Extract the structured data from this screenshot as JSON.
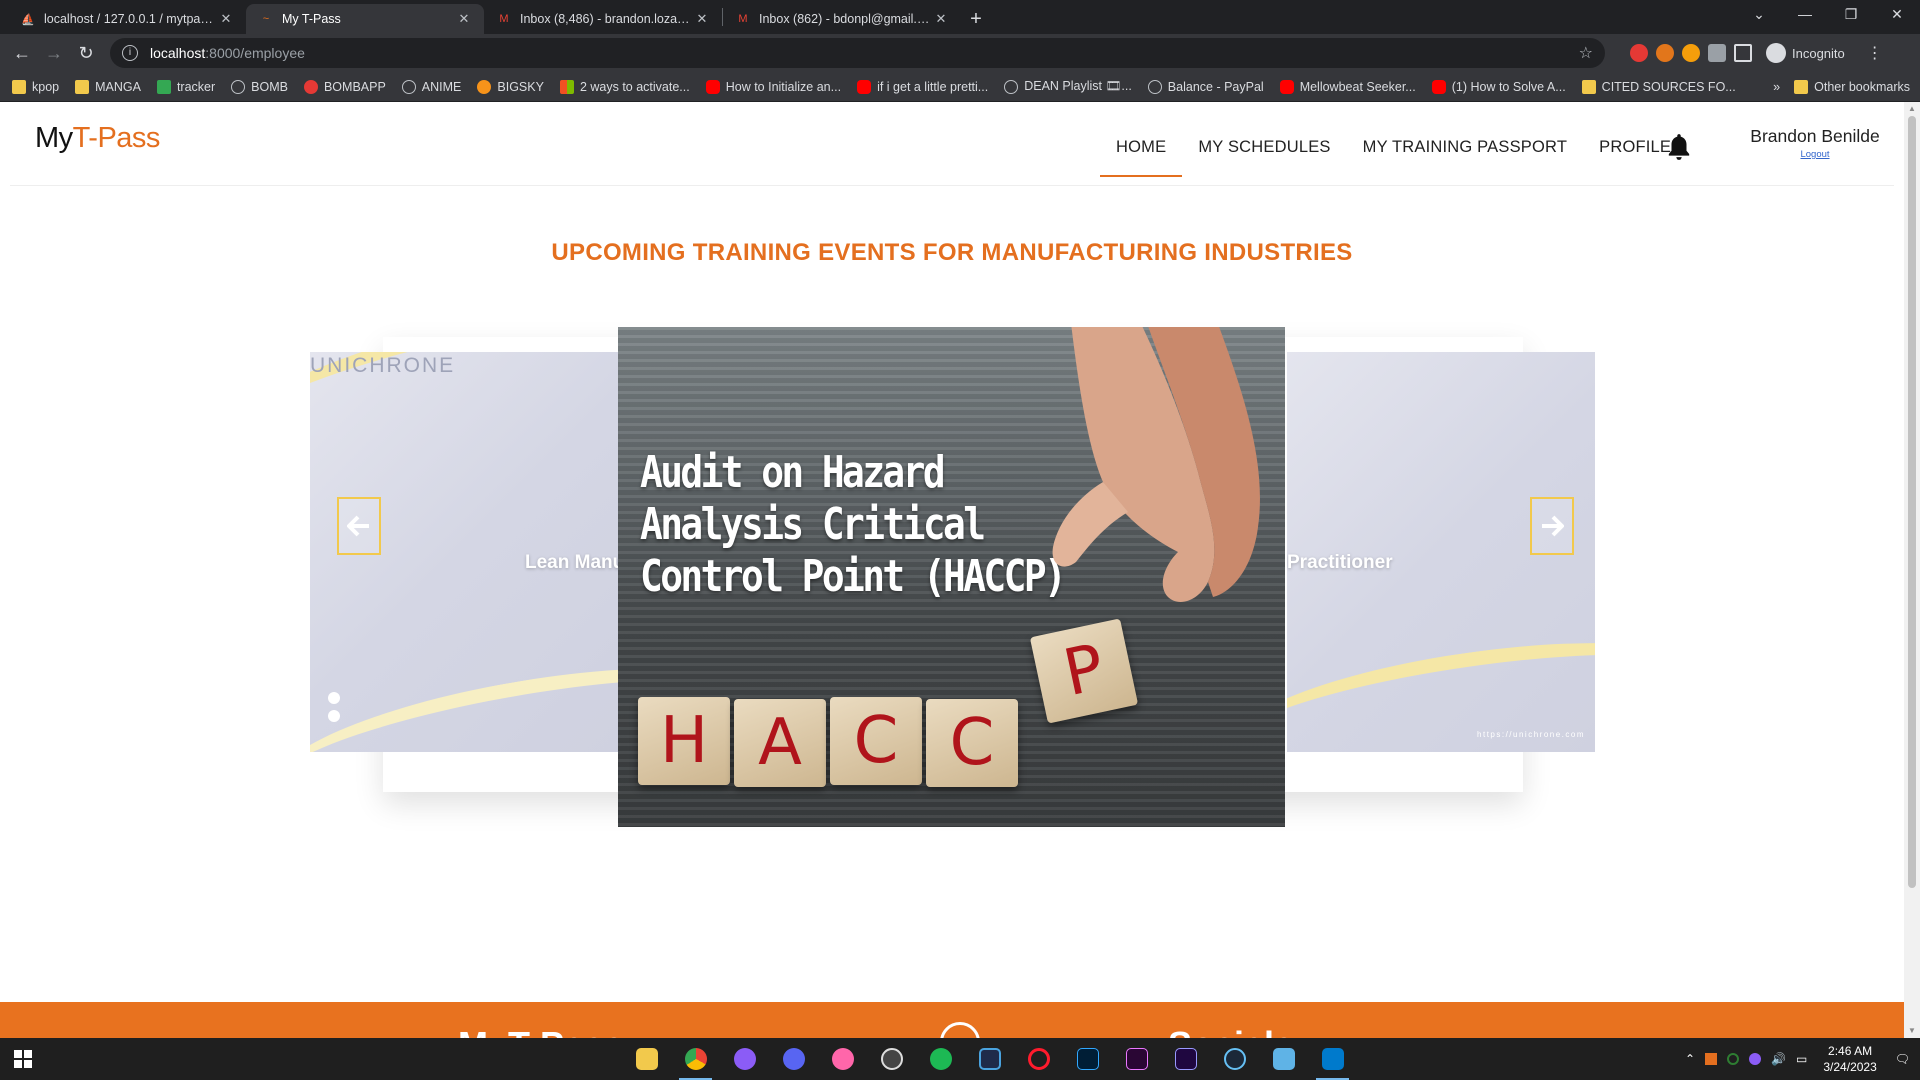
{
  "browser": {
    "tabs": [
      {
        "title": "localhost / 127.0.0.1 / mytpass / ",
        "favicon": "phpmyadmin-icon",
        "active": false
      },
      {
        "title": "My T-Pass",
        "favicon": "site-icon",
        "active": true
      },
      {
        "title": "Inbox (8,486) - brandon.lozano@",
        "favicon": "gmail-icon",
        "active": false
      },
      {
        "title": "Inbox (862) - bdonpl@gmail.com",
        "favicon": "gmail-icon",
        "active": false
      }
    ],
    "address": {
      "host": "localhost",
      "path": ":8000/employee"
    },
    "profile_label": "Incognito",
    "bookmarks": [
      "kpop",
      "MANGA",
      "tracker",
      "BOMB",
      "BOMBAPP",
      "ANIME",
      "BIGSKY",
      "2 ways to activate...",
      "How to Initialize an...",
      "if i get a little pretti...",
      "DEAN Playlist 🎞...",
      "Balance - PayPal",
      "Mellowbeat Seeker...",
      "(1) How to Solve A...",
      "CITED SOURCES FO..."
    ],
    "other_bookmarks": "Other bookmarks",
    "overflow": "»"
  },
  "site": {
    "logo_prefix": "My",
    "logo_accent": "T-Pass",
    "nav": [
      "HOME",
      "MY SCHEDULES",
      "MY TRAINING PASSPORT",
      "PROFILE"
    ],
    "active_nav": "HOME",
    "user_name": "Brandon Benilde",
    "logout": "Logout",
    "section_title": "UPCOMING TRAINING EVENTS FOR MANUFACTURING INDUSTRIES",
    "carousel": {
      "left_brand": "UNICHRONE",
      "left_caption": "Lean Manu",
      "right_caption": "Practitioner",
      "right_url": "https://unichrone.com",
      "main_headline": [
        "Audit on Hazard",
        "Analysis Critical",
        "Control Point (HACCP)"
      ],
      "blocks": [
        "H",
        "A",
        "C",
        "C",
        "P"
      ]
    },
    "footer_left": "MyT-Pass",
    "footer_right": "Socials"
  },
  "taskbar": {
    "time": "2:46 AM",
    "date": "3/24/2023"
  },
  "colors": {
    "accent": "#e46f1f",
    "arrow_border": "#f2c94c",
    "link": "#3366cc"
  }
}
